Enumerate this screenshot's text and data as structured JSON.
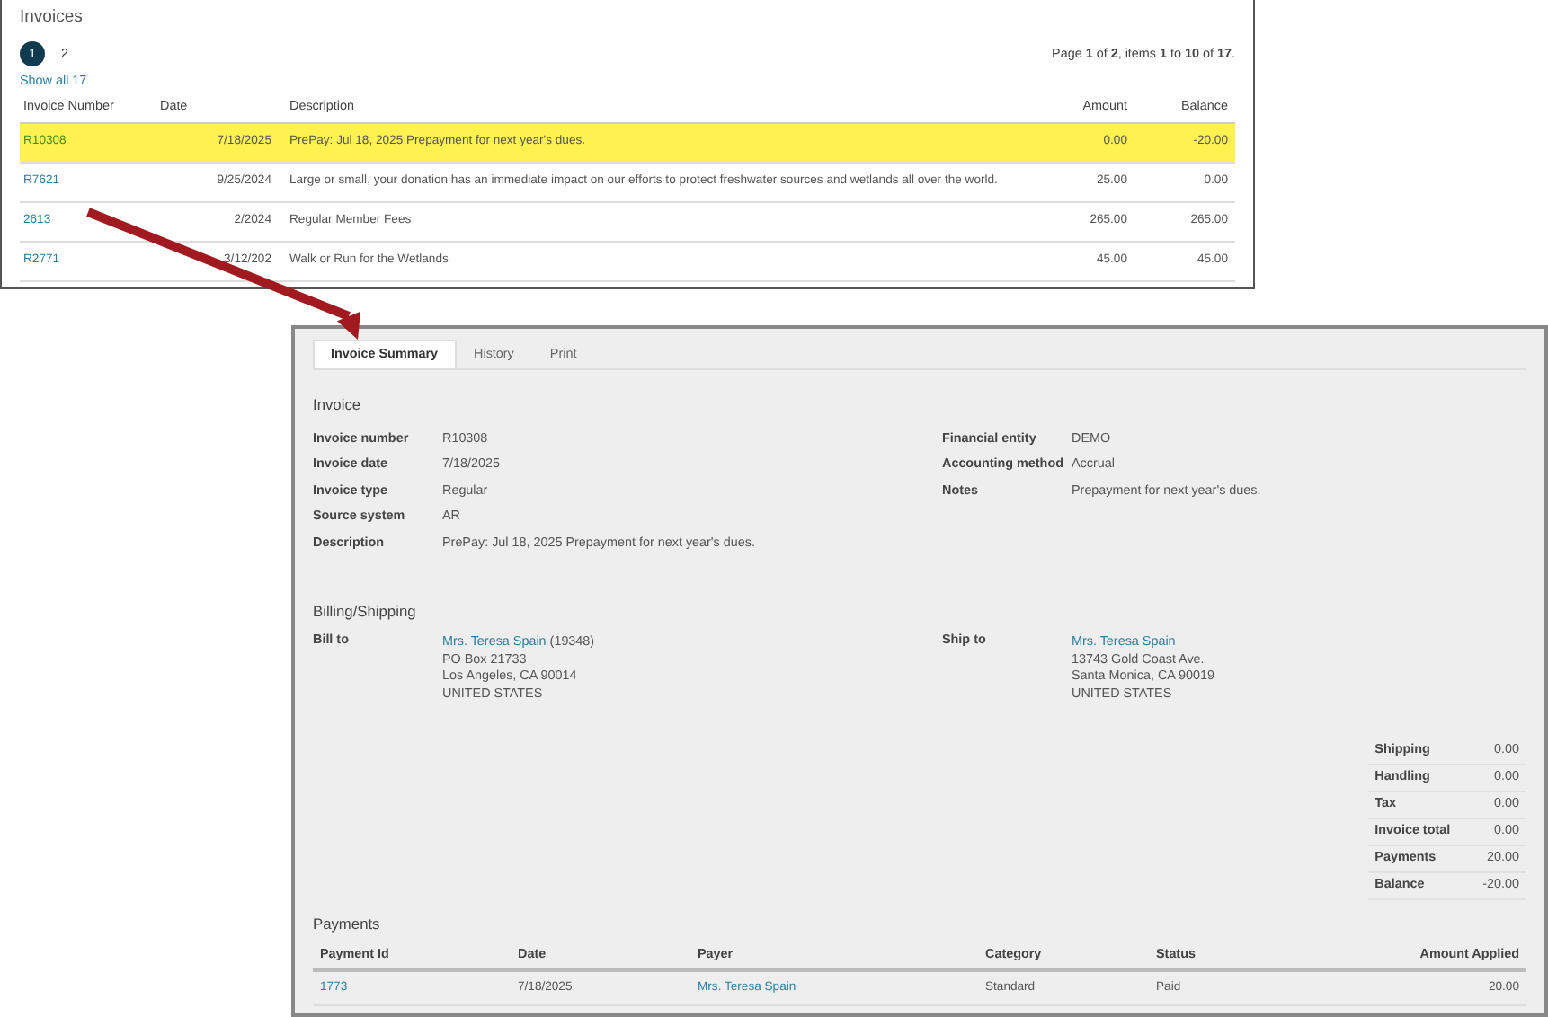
{
  "invoices_panel": {
    "title": "Invoices",
    "pages": [
      {
        "label": "1",
        "selected": true
      },
      {
        "label": "2",
        "selected": false
      }
    ],
    "page_info": "Page **1** of **2**, items **1** to **10** of **17**.",
    "show_all": "Show all 17",
    "columns": [
      "Invoice Number",
      "Date",
      "Description",
      "Amount",
      "Balance"
    ],
    "rows": [
      {
        "number": "R10308",
        "date": "7/18/2025",
        "description": "PrePay: Jul 18, 2025 Prepayment for next year's dues.",
        "amount": "0.00",
        "balance": "-20.00",
        "selected": true
      },
      {
        "number": "R7621",
        "date": "9/25/2024",
        "description": "Large or small, your donation has an immediate impact on our efforts to protect freshwater sources and wetlands all over the world.",
        "amount": "25.00",
        "balance": "0.00",
        "selected": false
      },
      {
        "number": "2613",
        "date": "2/2024",
        "description": "Regular Member Fees",
        "amount": "265.00",
        "balance": "265.00",
        "selected": false
      },
      {
        "number": "R2771",
        "date": "3/12/202",
        "description": "Walk or Run for the Wetlands",
        "amount": "45.00",
        "balance": "45.00",
        "selected": false
      }
    ]
  },
  "detail_panel": {
    "tabs": [
      {
        "label": "Invoice Summary",
        "selected": true
      },
      {
        "label": "History",
        "selected": false
      },
      {
        "label": "Print",
        "selected": false
      }
    ],
    "invoice": {
      "heading": "Invoice",
      "left_fields": [
        {
          "label": "Invoice number",
          "value": "R10308"
        },
        {
          "label": "Invoice date",
          "value": "7/18/2025"
        },
        {
          "label": "Invoice type",
          "value": "Regular"
        },
        {
          "label": "Source system",
          "value": "AR"
        },
        {
          "label": "Description",
          "value": "PrePay: Jul 18, 2025 Prepayment for next year's dues."
        }
      ],
      "right_fields": [
        {
          "label": "Financial entity",
          "value": "DEMO"
        },
        {
          "label": "Accounting method",
          "value": "Accrual"
        },
        {
          "label": "Notes",
          "value": "Prepayment for next year's dues."
        }
      ]
    },
    "billing": {
      "heading": "Billing/Shipping",
      "bill_to": {
        "label": "Bill to",
        "name": "Mrs. Teresa Spain",
        "id": "(19348)",
        "lines": [
          "PO Box 21733",
          "Los Angeles, CA 90014",
          "UNITED STATES"
        ]
      },
      "ship_to": {
        "label": "Ship to",
        "name": "Mrs. Teresa Spain",
        "lines": [
          "13743 Gold Coast Ave.",
          "Santa Monica, CA 90019",
          "UNITED STATES"
        ]
      }
    },
    "totals": [
      {
        "label": "Shipping",
        "value": "0.00"
      },
      {
        "label": "Handling",
        "value": "0.00"
      },
      {
        "label": "Tax",
        "value": "0.00"
      },
      {
        "label": "Invoice total",
        "value": "0.00"
      },
      {
        "label": "Payments",
        "value": "20.00"
      },
      {
        "label": "Balance",
        "value": "-20.00"
      }
    ],
    "payments": {
      "heading": "Payments",
      "columns": [
        "Payment Id",
        "Date",
        "Payer",
        "Category",
        "Status",
        "Amount Applied"
      ],
      "rows": [
        {
          "id": "1773",
          "date": "7/18/2025",
          "payer": "Mrs. Teresa Spain",
          "category": "Standard",
          "status": "Paid",
          "amount": "20.00"
        }
      ]
    }
  }
}
